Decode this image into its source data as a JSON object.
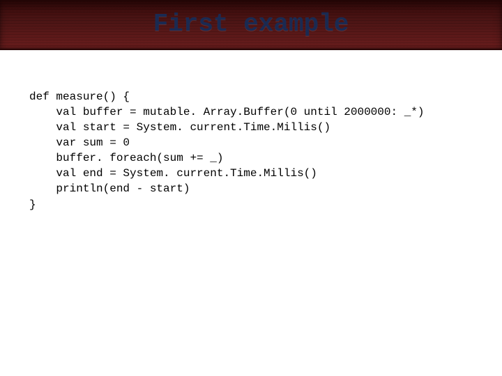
{
  "slide": {
    "title": "First example"
  },
  "code": {
    "line1": "def measure() {",
    "line2": "    val buffer = mutable. Array.Buffer(0 until 2000000: _*)",
    "line3": "    val start = System. current.Time.Millis()",
    "line4": "    var sum = 0",
    "line5": "    buffer. foreach(sum += _)",
    "line6": "    val end = System. current.Time.Millis()",
    "line7": "    println(end - start)",
    "line8": "}"
  }
}
